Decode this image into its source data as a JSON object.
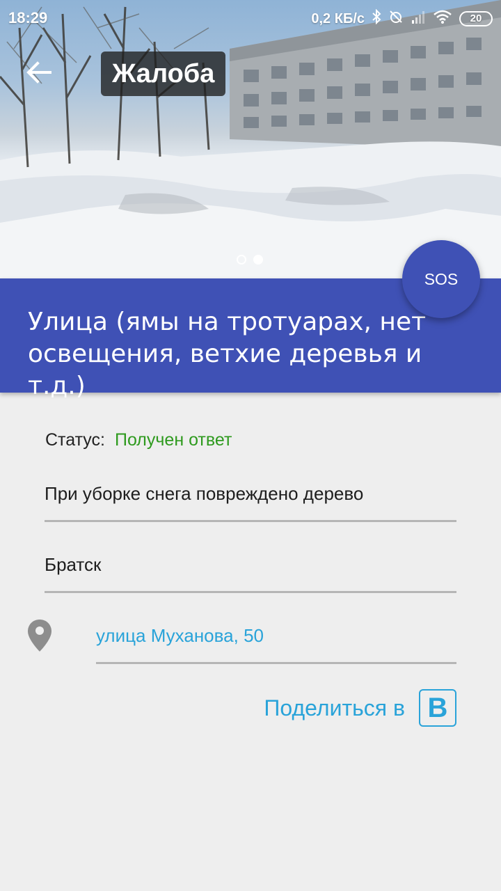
{
  "status_bar": {
    "time": "18:29",
    "network_speed": "0,2 КБ/с",
    "battery": "20",
    "icons": [
      "bluetooth-icon",
      "alarm-off-icon",
      "signal-icon",
      "wifi-icon",
      "battery-icon"
    ]
  },
  "toolbar": {
    "title": "Жалоба",
    "back_icon": "arrow-back-icon"
  },
  "gallery": {
    "page_count": 2,
    "active_page": 2
  },
  "sos_button": {
    "label": "SOS"
  },
  "category": {
    "text": "Улица (ямы на тротуарах, нет освещения, ветхие деревья и т.д.)"
  },
  "complaint": {
    "status_label": "Статус:",
    "status_value": "Получен ответ",
    "description": "При уборке снега повреждено дерево",
    "city": "Братск",
    "address": "улица Муханова, 50",
    "location_icon": "map-pin-icon"
  },
  "share": {
    "label": "Поделиться в",
    "network_icon": "vk-icon",
    "network_letter": "B"
  },
  "colors": {
    "primary": "#3f51b5",
    "status_ok": "#2e9a1e",
    "link": "#29a3d9",
    "background": "#eeeeee"
  }
}
